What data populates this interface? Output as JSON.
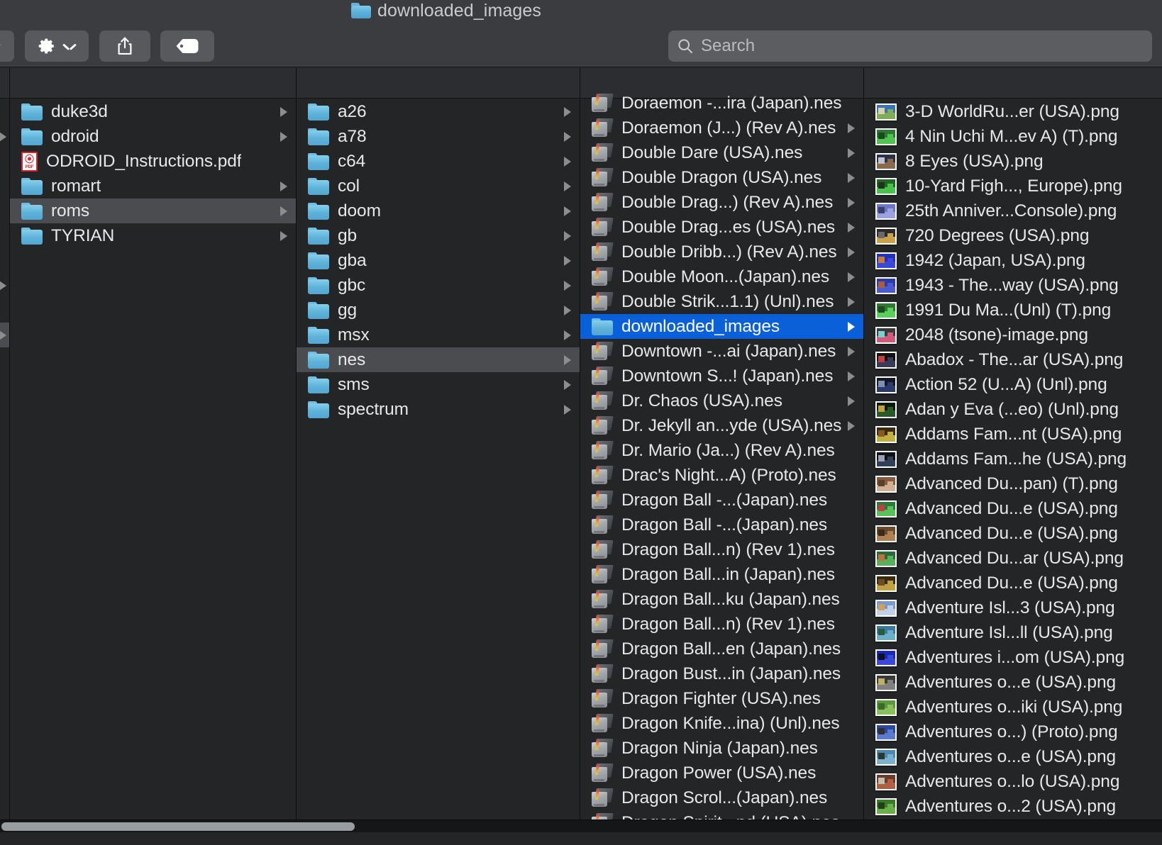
{
  "window": {
    "title": "downloaded_images",
    "title_icon": "folder-icon"
  },
  "toolbar": {
    "cut_off_button_icon": "chevron-down-icon",
    "action_menu_label": "",
    "action_menu_icon": "gear-icon",
    "action_menu_chevron_icon": "chevron-down-icon",
    "share_button_icon": "share-icon",
    "tag_button_icon": "tag-icon"
  },
  "search": {
    "icon": "search-icon",
    "placeholder": "Search",
    "value": ""
  },
  "columns": [
    {
      "name": "column-sliver",
      "items": [
        {
          "label": "",
          "icon": "none",
          "arrow": false,
          "selected": "none"
        },
        {
          "label": "",
          "icon": "none",
          "arrow": true,
          "selected": "none"
        },
        {
          "label": "",
          "icon": "none",
          "arrow": false,
          "selected": "none"
        },
        {
          "label": "",
          "icon": "none",
          "arrow": false,
          "selected": "none"
        },
        {
          "label": "",
          "icon": "none",
          "arrow": false,
          "selected": "none"
        },
        {
          "label": "",
          "icon": "none",
          "arrow": false,
          "selected": "none"
        },
        {
          "label": "",
          "icon": "none",
          "arrow": false,
          "selected": "none"
        },
        {
          "label": "",
          "icon": "none",
          "arrow": true,
          "selected": "none"
        },
        {
          "label": "",
          "icon": "none",
          "arrow": false,
          "selected": "none"
        },
        {
          "label": "",
          "icon": "none",
          "arrow": true,
          "selected": "gray"
        }
      ]
    },
    {
      "name": "column-home",
      "items": [
        {
          "label": "duke3d",
          "icon": "folder",
          "arrow": true,
          "selected": "none"
        },
        {
          "label": "odroid",
          "icon": "folder",
          "arrow": true,
          "selected": "none"
        },
        {
          "label": "ODROID_Instructions.pdf",
          "icon": "pdf",
          "arrow": false,
          "selected": "none"
        },
        {
          "label": "romart",
          "icon": "folder",
          "arrow": true,
          "selected": "none"
        },
        {
          "label": "roms",
          "icon": "folder",
          "arrow": true,
          "selected": "gray"
        },
        {
          "label": "TYRIAN",
          "icon": "folder",
          "arrow": true,
          "selected": "none"
        }
      ]
    },
    {
      "name": "column-roms",
      "items": [
        {
          "label": "a26",
          "icon": "folder",
          "arrow": true,
          "selected": "none"
        },
        {
          "label": "a78",
          "icon": "folder",
          "arrow": true,
          "selected": "none"
        },
        {
          "label": "c64",
          "icon": "folder",
          "arrow": true,
          "selected": "none"
        },
        {
          "label": "col",
          "icon": "folder",
          "arrow": true,
          "selected": "none"
        },
        {
          "label": "doom",
          "icon": "folder",
          "arrow": true,
          "selected": "none"
        },
        {
          "label": "gb",
          "icon": "folder",
          "arrow": true,
          "selected": "none"
        },
        {
          "label": "gba",
          "icon": "folder",
          "arrow": true,
          "selected": "none"
        },
        {
          "label": "gbc",
          "icon": "folder",
          "arrow": true,
          "selected": "none"
        },
        {
          "label": "gg",
          "icon": "folder",
          "arrow": true,
          "selected": "none"
        },
        {
          "label": "msx",
          "icon": "folder",
          "arrow": true,
          "selected": "none"
        },
        {
          "label": "nes",
          "icon": "folder",
          "arrow": true,
          "selected": "gray"
        },
        {
          "label": "sms",
          "icon": "folder",
          "arrow": true,
          "selected": "none"
        },
        {
          "label": "spectrum",
          "icon": "folder",
          "arrow": true,
          "selected": "none"
        }
      ]
    },
    {
      "name": "column-nes",
      "items": [
        {
          "label": "Doraemon -...ira (Japan).nes",
          "icon": "cartridge",
          "arrow": false,
          "selected": "none"
        },
        {
          "label": "Doraemon (J...) (Rev A).nes",
          "icon": "cartridge",
          "arrow": true,
          "selected": "none"
        },
        {
          "label": "Double Dare (USA).nes",
          "icon": "cartridge",
          "arrow": true,
          "selected": "none"
        },
        {
          "label": "Double Dragon (USA).nes",
          "icon": "cartridge",
          "arrow": true,
          "selected": "none"
        },
        {
          "label": "Double Drag...) (Rev A).nes",
          "icon": "cartridge",
          "arrow": true,
          "selected": "none"
        },
        {
          "label": "Double Drag...es (USA).nes",
          "icon": "cartridge",
          "arrow": true,
          "selected": "none"
        },
        {
          "label": "Double Dribb...) (Rev A).nes",
          "icon": "cartridge",
          "arrow": true,
          "selected": "none"
        },
        {
          "label": "Double Moon...(Japan).nes",
          "icon": "cartridge",
          "arrow": true,
          "selected": "none"
        },
        {
          "label": "Double Strik...1.1) (Unl).nes",
          "icon": "cartridge",
          "arrow": true,
          "selected": "none"
        },
        {
          "label": "downloaded_images",
          "icon": "folder",
          "arrow": true,
          "selected": "blue"
        },
        {
          "label": "Downtown -...ai (Japan).nes",
          "icon": "cartridge",
          "arrow": true,
          "selected": "none"
        },
        {
          "label": "Downtown S...! (Japan).nes",
          "icon": "cartridge",
          "arrow": true,
          "selected": "none"
        },
        {
          "label": "Dr. Chaos (USA).nes",
          "icon": "cartridge",
          "arrow": true,
          "selected": "none"
        },
        {
          "label": "Dr. Jekyll an...yde (USA).nes",
          "icon": "cartridge",
          "arrow": true,
          "selected": "none"
        },
        {
          "label": "Dr. Mario (Ja...) (Rev A).nes",
          "icon": "cartridge",
          "arrow": false,
          "selected": "none"
        },
        {
          "label": "Drac's Night...A) (Proto).nes",
          "icon": "cartridge",
          "arrow": false,
          "selected": "none"
        },
        {
          "label": "Dragon Ball -...(Japan).nes",
          "icon": "cartridge",
          "arrow": false,
          "selected": "none"
        },
        {
          "label": "Dragon Ball -...(Japan).nes",
          "icon": "cartridge",
          "arrow": false,
          "selected": "none"
        },
        {
          "label": "Dragon Ball...n) (Rev 1).nes",
          "icon": "cartridge",
          "arrow": false,
          "selected": "none"
        },
        {
          "label": "Dragon Ball...in (Japan).nes",
          "icon": "cartridge",
          "arrow": false,
          "selected": "none"
        },
        {
          "label": "Dragon Ball...ku (Japan).nes",
          "icon": "cartridge",
          "arrow": false,
          "selected": "none"
        },
        {
          "label": "Dragon Ball...n) (Rev 1).nes",
          "icon": "cartridge",
          "arrow": false,
          "selected": "none"
        },
        {
          "label": "Dragon Ball...en (Japan).nes",
          "icon": "cartridge",
          "arrow": false,
          "selected": "none"
        },
        {
          "label": "Dragon Bust...in (Japan).nes",
          "icon": "cartridge",
          "arrow": false,
          "selected": "none"
        },
        {
          "label": "Dragon Fighter (USA).nes",
          "icon": "cartridge",
          "arrow": false,
          "selected": "none"
        },
        {
          "label": "Dragon Knife...ina) (Unl).nes",
          "icon": "cartridge",
          "arrow": false,
          "selected": "none"
        },
        {
          "label": "Dragon Ninja (Japan).nes",
          "icon": "cartridge",
          "arrow": false,
          "selected": "none"
        },
        {
          "label": "Dragon Power (USA).nes",
          "icon": "cartridge",
          "arrow": false,
          "selected": "none"
        },
        {
          "label": "Dragon Scrol...(Japan).nes",
          "icon": "cartridge",
          "arrow": false,
          "selected": "none"
        },
        {
          "label": "Dragon Spirit...nd (USA).nes",
          "icon": "cartridge",
          "arrow": false,
          "selected": "none"
        }
      ]
    },
    {
      "name": "column-downloaded-images",
      "items": [
        {
          "label": "3-D WorldRu...er (USA).png",
          "icon": "image",
          "thumb": [
            "#3a72b8",
            "#7fae56",
            "#d9d2b0"
          ],
          "arrow": false,
          "selected": "none"
        },
        {
          "label": "4 Nin Uchi M...ev A) (T).png",
          "icon": "image",
          "thumb": [
            "#2f7a33",
            "#4fc24f",
            "#1c4a20"
          ],
          "arrow": false,
          "selected": "none"
        },
        {
          "label": "8 Eyes (USA).png",
          "icon": "image",
          "thumb": [
            "#2a2f4a",
            "#8a6a48",
            "#c0c4d0"
          ],
          "arrow": false,
          "selected": "none"
        },
        {
          "label": "10-Yard Figh..., Europe).png",
          "icon": "image",
          "thumb": [
            "#1e6a22",
            "#48c24c",
            "#223020"
          ],
          "arrow": false,
          "selected": "none"
        },
        {
          "label": "25th Anniver...Console).png",
          "icon": "image",
          "thumb": [
            "#6e76c8",
            "#9aa2e0",
            "#3a3f70"
          ],
          "arrow": false,
          "selected": "none"
        },
        {
          "label": "720 Degrees (USA).png",
          "icon": "image",
          "thumb": [
            "#2a2a2a",
            "#c9a24a",
            "#6a6a6a"
          ],
          "arrow": false,
          "selected": "none"
        },
        {
          "label": "1942 (Japan, USA).png",
          "icon": "image",
          "thumb": [
            "#2030b8",
            "#3a4ad8",
            "#c87a3a"
          ],
          "arrow": false,
          "selected": "none"
        },
        {
          "label": "1943 - The...way (USA).png",
          "icon": "image",
          "thumb": [
            "#2a3ab0",
            "#4a5ad0",
            "#b05a3a"
          ],
          "arrow": false,
          "selected": "none"
        },
        {
          "label": "1991 Du Ma...(Unl) (T).png",
          "icon": "image",
          "thumb": [
            "#2f7a33",
            "#5ad05a",
            "#1c4a20"
          ],
          "arrow": false,
          "selected": "none"
        },
        {
          "label": "2048 (tsone)-image.png",
          "icon": "image",
          "thumb": [
            "#3a3a3a",
            "#d05a7a",
            "#7ad0d0"
          ],
          "arrow": false,
          "selected": "none"
        },
        {
          "label": "Abadox - The...ar (USA).png",
          "icon": "image",
          "thumb": [
            "#101010",
            "#3a3a5a",
            "#c04040"
          ],
          "arrow": false,
          "selected": "none"
        },
        {
          "label": "Action 52 (U...A) (Unl).png",
          "icon": "image",
          "thumb": [
            "#101828",
            "#2a3a6a",
            "#8090b0"
          ],
          "arrow": false,
          "selected": "none"
        },
        {
          "label": "Adan y Eva (...eo) (Unl).png",
          "icon": "image",
          "thumb": [
            "#0a1a0a",
            "#2a5a2a",
            "#c0a040"
          ],
          "arrow": false,
          "selected": "none"
        },
        {
          "label": "Addams Fam...nt (USA).png",
          "icon": "image",
          "thumb": [
            "#3a2a10",
            "#c0b040",
            "#8a5a20"
          ],
          "arrow": false,
          "selected": "none"
        },
        {
          "label": "Addams Fam...he (USA).png",
          "icon": "image",
          "thumb": [
            "#101014",
            "#30405a",
            "#9aa0b0"
          ],
          "arrow": false,
          "selected": "none"
        },
        {
          "label": "Advanced Du...pan) (T).png",
          "icon": "image",
          "thumb": [
            "#8a5a3a",
            "#d0b090",
            "#5a4030"
          ],
          "arrow": false,
          "selected": "none"
        },
        {
          "label": "Advanced Du...e (USA).png",
          "icon": "image",
          "thumb": [
            "#2a7a3a",
            "#5ac05a",
            "#c04040"
          ],
          "arrow": false,
          "selected": "none"
        },
        {
          "label": "Advanced Du...e (USA).png",
          "icon": "image",
          "thumb": [
            "#6a4a2a",
            "#b08050",
            "#3a2a1a"
          ],
          "arrow": false,
          "selected": "none"
        },
        {
          "label": "Advanced Du...ar (USA).png",
          "icon": "image",
          "thumb": [
            "#2a6a3a",
            "#5ab05a",
            "#c07040"
          ],
          "arrow": false,
          "selected": "none"
        },
        {
          "label": "Advanced Du...e (USA).png",
          "icon": "image",
          "thumb": [
            "#3a2a10",
            "#c0a040",
            "#6a5020"
          ],
          "arrow": false,
          "selected": "none"
        },
        {
          "label": "Adventure Isl...3 (USA).png",
          "icon": "image",
          "thumb": [
            "#7a9ac8",
            "#c0d0e8",
            "#d0a060"
          ],
          "arrow": false,
          "selected": "none"
        },
        {
          "label": "Adventure Isl...ll (USA).png",
          "icon": "image",
          "thumb": [
            "#3a7aa0",
            "#6ab0c8",
            "#2a5a3a"
          ],
          "arrow": false,
          "selected": "none"
        },
        {
          "label": "Adventures i...om (USA).png",
          "icon": "image",
          "thumb": [
            "#1a2ab8",
            "#3a4ad8",
            "#101020"
          ],
          "arrow": false,
          "selected": "none"
        },
        {
          "label": "Adventures o...e (USA).png",
          "icon": "image",
          "thumb": [
            "#3a3a3a",
            "#808080",
            "#c0b060"
          ],
          "arrow": false,
          "selected": "none"
        },
        {
          "label": "Adventures o...iki (USA).png",
          "icon": "image",
          "thumb": [
            "#5a9a3a",
            "#8ac05a",
            "#3a6a2a"
          ],
          "arrow": false,
          "selected": "none"
        },
        {
          "label": "Adventures o...) (Proto).png",
          "icon": "image",
          "thumb": [
            "#2a4aa0",
            "#5a7ad0",
            "#303030"
          ],
          "arrow": false,
          "selected": "none"
        },
        {
          "label": "Adventures o...e (USA).png",
          "icon": "image",
          "thumb": [
            "#4a8ab0",
            "#7ab0d0",
            "#2a3a2a"
          ],
          "arrow": false,
          "selected": "none"
        },
        {
          "label": "Adventures o...lo (USA).png",
          "icon": "image",
          "thumb": [
            "#6a3a2a",
            "#b06040",
            "#c0c0b0"
          ],
          "arrow": false,
          "selected": "none"
        },
        {
          "label": "Adventures o...2 (USA).png",
          "icon": "image",
          "thumb": [
            "#3a7a2a",
            "#6ab04a",
            "#204018"
          ],
          "arrow": false,
          "selected": "none"
        }
      ]
    }
  ],
  "scrollbar": {
    "orientation": "horizontal"
  }
}
